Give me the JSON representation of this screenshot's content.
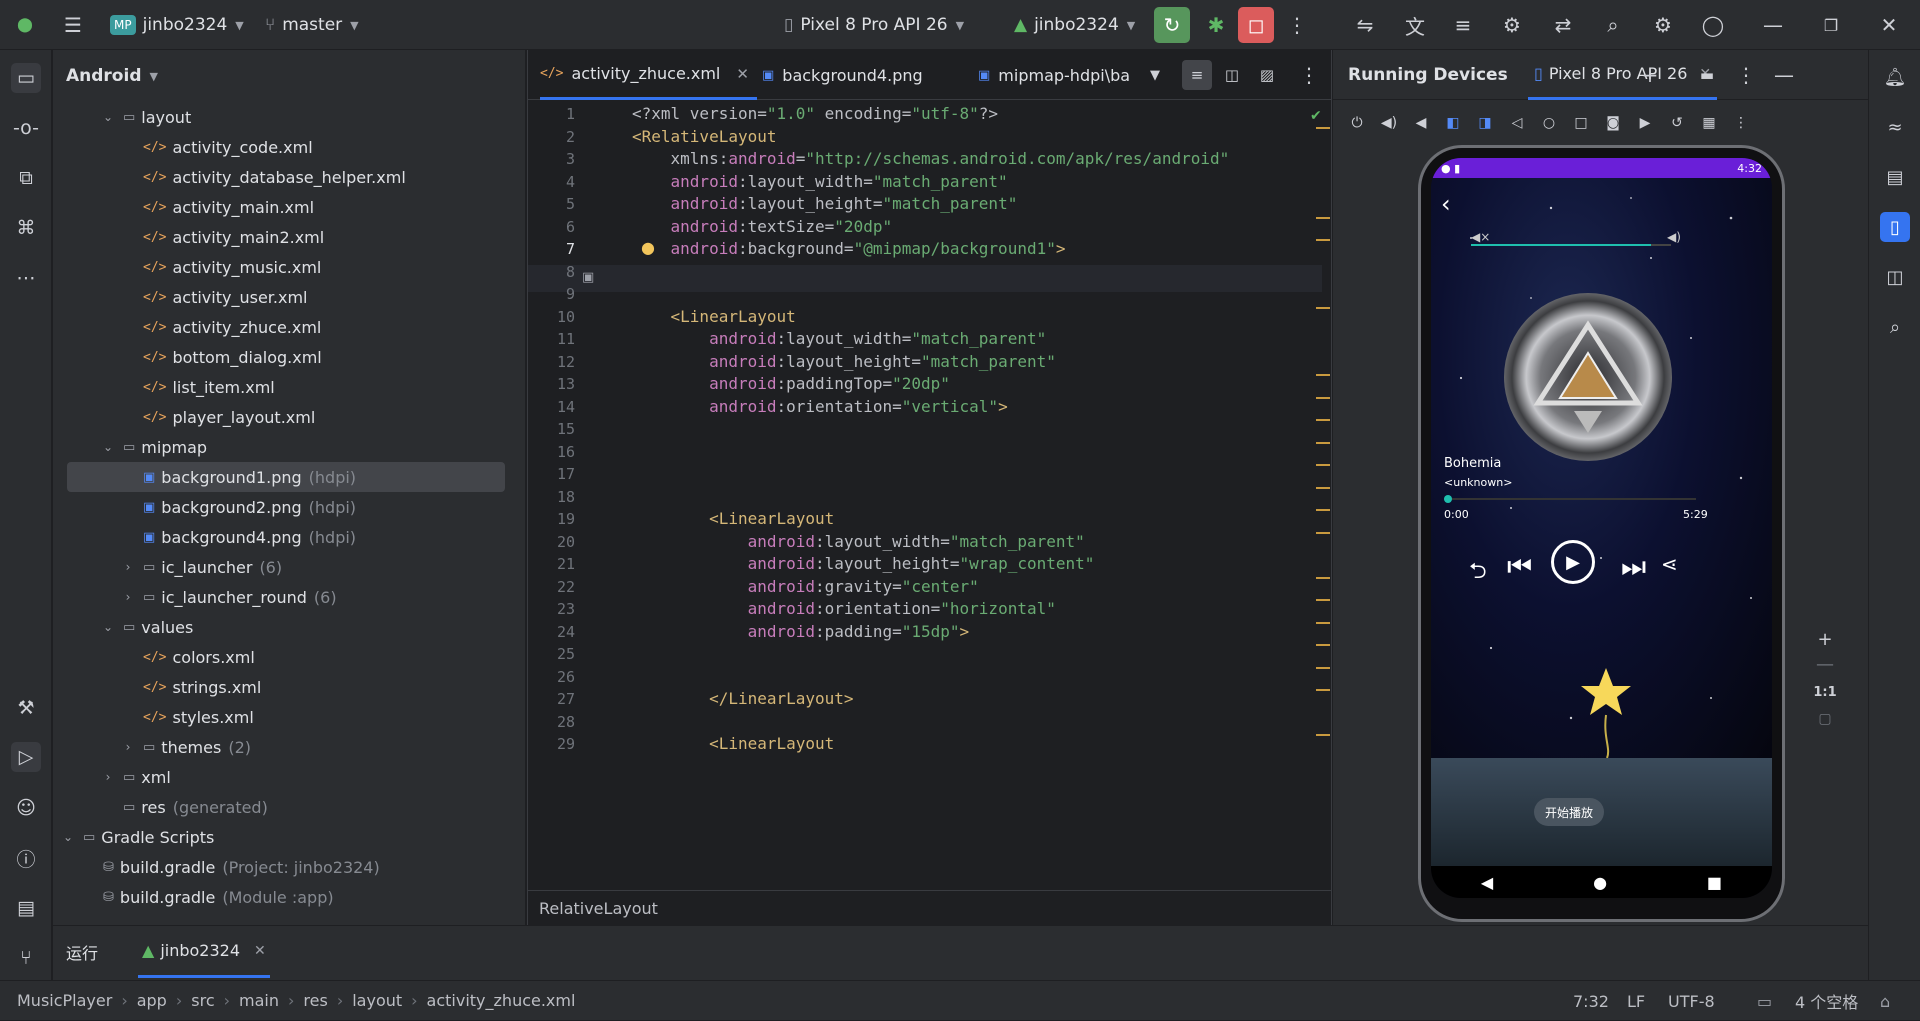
{
  "topbar": {
    "project_badge": "MP",
    "project_name": "jinbo2324",
    "branch": "master",
    "device": "Pixel 8 Pro API 26",
    "account": "jinbo2324"
  },
  "project_panel": {
    "view_label": "Android",
    "items": [
      {
        "label": "layout",
        "hint": "",
        "kind": "folder",
        "indent": 2,
        "open": true
      },
      {
        "label": "activity_code.xml",
        "hint": "",
        "kind": "xml",
        "indent": 3
      },
      {
        "label": "activity_database_helper.xml",
        "hint": "",
        "kind": "xml",
        "indent": 3
      },
      {
        "label": "activity_main.xml",
        "hint": "",
        "kind": "xml",
        "indent": 3
      },
      {
        "label": "activity_main2.xml",
        "hint": "",
        "kind": "xml",
        "indent": 3
      },
      {
        "label": "activity_music.xml",
        "hint": "",
        "kind": "xml",
        "indent": 3
      },
      {
        "label": "activity_user.xml",
        "hint": "",
        "kind": "xml",
        "indent": 3
      },
      {
        "label": "activity_zhuce.xml",
        "hint": "",
        "kind": "xml",
        "indent": 3
      },
      {
        "label": "bottom_dialog.xml",
        "hint": "",
        "kind": "xml",
        "indent": 3
      },
      {
        "label": "list_item.xml",
        "hint": "",
        "kind": "xml",
        "indent": 3
      },
      {
        "label": "player_layout.xml",
        "hint": "",
        "kind": "xml",
        "indent": 3
      },
      {
        "label": "mipmap",
        "hint": "",
        "kind": "folder",
        "indent": 2,
        "open": true
      },
      {
        "label": "background1.png",
        "hint": "(hdpi)",
        "kind": "img",
        "indent": 3,
        "selected": true
      },
      {
        "label": "background2.png",
        "hint": "(hdpi)",
        "kind": "img",
        "indent": 3
      },
      {
        "label": "background4.png",
        "hint": "(hdpi)",
        "kind": "img",
        "indent": 3
      },
      {
        "label": "ic_launcher",
        "hint": "(6)",
        "kind": "folder",
        "indent": 3,
        "open": false
      },
      {
        "label": "ic_launcher_round",
        "hint": "(6)",
        "kind": "folder",
        "indent": 3,
        "open": false
      },
      {
        "label": "values",
        "hint": "",
        "kind": "folder",
        "indent": 2,
        "open": true
      },
      {
        "label": "colors.xml",
        "hint": "",
        "kind": "xml",
        "indent": 3
      },
      {
        "label": "strings.xml",
        "hint": "",
        "kind": "xml",
        "indent": 3
      },
      {
        "label": "styles.xml",
        "hint": "",
        "kind": "xml",
        "indent": 3
      },
      {
        "label": "themes",
        "hint": "(2)",
        "kind": "folder",
        "indent": 3,
        "open": false
      },
      {
        "label": "xml",
        "hint": "",
        "kind": "folder",
        "indent": 2,
        "open": false
      },
      {
        "label": "res",
        "hint": "(generated)",
        "kind": "res",
        "indent": 2
      },
      {
        "label": "Gradle Scripts",
        "hint": "",
        "kind": "gradle-folder",
        "indent": 0,
        "open": true
      },
      {
        "label": "build.gradle",
        "hint": "(Project: jinbo2324)",
        "kind": "gradle",
        "indent": 1
      },
      {
        "label": "build.gradle",
        "hint": "(Module :app)",
        "kind": "gradle",
        "indent": 1
      }
    ]
  },
  "editor": {
    "tabs": [
      {
        "label": "activity_zhuce.xml",
        "active": true
      },
      {
        "label": "background4.png",
        "active": false
      },
      {
        "label": "mipmap-hdpi\\ba",
        "active": false
      }
    ],
    "breadcrumb": "RelativeLayout",
    "lines": [
      {
        "n": "1",
        "t": [
          [
            "p",
            "<?xml version="
          ],
          [
            "s",
            "\"1.0\""
          ],
          [
            "p",
            " encoding="
          ],
          [
            "s",
            "\"utf-8\""
          ],
          [
            "p",
            "?>"
          ]
        ]
      },
      {
        "n": "2",
        "t": [
          [
            "g",
            "<RelativeLayout"
          ]
        ]
      },
      {
        "n": "3",
        "t": [
          [
            "a",
            "    xmlns:"
          ],
          [
            "n",
            "android"
          ],
          [
            "a",
            "="
          ],
          [
            "s",
            "\"http://schemas.android.com/apk/res/android\""
          ]
        ]
      },
      {
        "n": "4",
        "t": [
          [
            "n",
            "    android"
          ],
          [
            "a",
            ":layout_width="
          ],
          [
            "s",
            "\"match_parent\""
          ]
        ]
      },
      {
        "n": "5",
        "t": [
          [
            "n",
            "    android"
          ],
          [
            "a",
            ":layout_height="
          ],
          [
            "s",
            "\"match_parent\""
          ]
        ]
      },
      {
        "n": "6",
        "t": [
          [
            "n",
            "    android"
          ],
          [
            "a",
            ":textSize="
          ],
          [
            "s",
            "\"20dp\""
          ]
        ]
      },
      {
        "n": "7",
        "t": [
          [
            "n",
            "    android"
          ],
          [
            "a",
            ":background="
          ],
          [
            "s",
            "\"@mipmap/background1\""
          ],
          [
            "g",
            ">"
          ]
        ]
      },
      {
        "n": "8",
        "t": []
      },
      {
        "n": "9",
        "t": []
      },
      {
        "n": "10",
        "t": [
          [
            "g",
            "    <LinearLayout"
          ]
        ]
      },
      {
        "n": "11",
        "t": [
          [
            "n",
            "        android"
          ],
          [
            "a",
            ":layout_width="
          ],
          [
            "s",
            "\"match_parent\""
          ]
        ]
      },
      {
        "n": "12",
        "t": [
          [
            "n",
            "        android"
          ],
          [
            "a",
            ":layout_height="
          ],
          [
            "s",
            "\"match_parent\""
          ]
        ]
      },
      {
        "n": "13",
        "t": [
          [
            "n",
            "        android"
          ],
          [
            "a",
            ":paddingTop="
          ],
          [
            "s",
            "\"20dp\""
          ]
        ]
      },
      {
        "n": "14",
        "t": [
          [
            "n",
            "        android"
          ],
          [
            "a",
            ":orientation="
          ],
          [
            "s",
            "\"vertical\""
          ],
          [
            "g",
            ">"
          ]
        ]
      },
      {
        "n": "15",
        "t": []
      },
      {
        "n": "16",
        "t": []
      },
      {
        "n": "17",
        "t": []
      },
      {
        "n": "18",
        "t": []
      },
      {
        "n": "19",
        "t": [
          [
            "g",
            "        <LinearLayout"
          ]
        ]
      },
      {
        "n": "20",
        "t": [
          [
            "n",
            "            android"
          ],
          [
            "a",
            ":layout_width="
          ],
          [
            "s",
            "\"match_parent\""
          ]
        ]
      },
      {
        "n": "21",
        "t": [
          [
            "n",
            "            android"
          ],
          [
            "a",
            ":layout_height="
          ],
          [
            "s",
            "\"wrap_content\""
          ]
        ]
      },
      {
        "n": "22",
        "t": [
          [
            "n",
            "            android"
          ],
          [
            "a",
            ":gravity="
          ],
          [
            "s",
            "\"center\""
          ]
        ]
      },
      {
        "n": "23",
        "t": [
          [
            "n",
            "            android"
          ],
          [
            "a",
            ":orientation="
          ],
          [
            "s",
            "\"horizontal\""
          ]
        ]
      },
      {
        "n": "24",
        "t": [
          [
            "n",
            "            android"
          ],
          [
            "a",
            ":padding="
          ],
          [
            "s",
            "\"15dp\""
          ],
          [
            "g",
            ">"
          ]
        ]
      },
      {
        "n": "25",
        "t": []
      },
      {
        "n": "26",
        "t": []
      },
      {
        "n": "27",
        "t": [
          [
            "g",
            "        </LinearLayout>"
          ]
        ]
      },
      {
        "n": "28",
        "t": []
      },
      {
        "n": "29",
        "t": [
          [
            "g",
            "        <LinearLayout"
          ]
        ]
      }
    ]
  },
  "running_devices": {
    "title": "Running Devices",
    "device_tab": "Pixel 8 Pro API 26",
    "phone": {
      "time": "4:32",
      "song_title": "Bohemia",
      "artist": "<unknown>",
      "elapsed": "0:00",
      "duration": "5:29",
      "play_button_label": "开始播放",
      "volume_level": 0.9,
      "progress": 0.0
    },
    "zoom_label": "1:1"
  },
  "bottom_tabs": {
    "run_label": "运行",
    "config_label": "jinbo2324"
  },
  "statusbar": {
    "path": [
      "MusicPlayer",
      "app",
      "src",
      "main",
      "res",
      "layout",
      "activity_zhuce.xml"
    ],
    "position": "7:32",
    "line_sep": "LF",
    "encoding": "UTF-8",
    "indent": "4 个空格"
  },
  "colors": {
    "accent": "#3574f0",
    "run_green": "#57965c",
    "stop_red": "#db5c5c",
    "statusbar_purple": "#6a1fd8"
  }
}
